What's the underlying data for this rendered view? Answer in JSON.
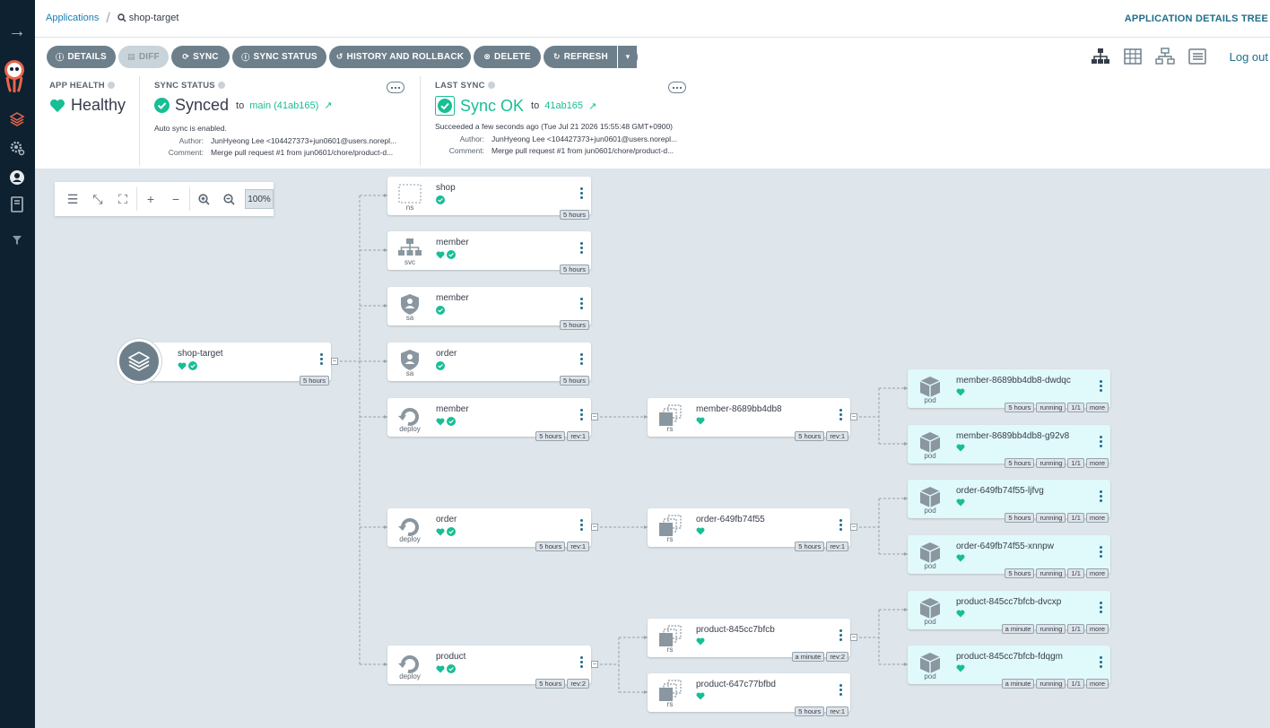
{
  "topbar": {
    "breadcrumb_root": "Applications",
    "breadcrumb_current": "shop-target",
    "page_title": "APPLICATION DETAILS TREE",
    "logout": "Log out"
  },
  "toolbar": {
    "details": "DETAILS",
    "diff": "DIFF",
    "sync": "SYNC",
    "sync_status": "SYNC STATUS",
    "history": "HISTORY AND ROLLBACK",
    "delete": "DELETE",
    "refresh": "REFRESH"
  },
  "health": {
    "label": "APP HEALTH",
    "value": "Healthy"
  },
  "sync_status": {
    "label": "SYNC STATUS",
    "value": "Synced",
    "to": "to",
    "revision": "main (41ab165)",
    "auto_sync": "Auto sync is enabled.",
    "author_label": "Author:",
    "author": "JunHyeong Lee <104427373+jun0601@users.norepl...",
    "comment_label": "Comment:",
    "comment": "Merge pull request #1 from jun0601/chore/product-d..."
  },
  "last_sync": {
    "label": "LAST SYNC",
    "value": "Sync OK",
    "to": "to",
    "revision": "41ab165",
    "succeeded": "Succeeded a few seconds ago (Tue Jul 21 2026 15:55:48 GMT+0900)",
    "author_label": "Author:",
    "author": "JunHyeong Lee <104427373+jun0601@users.norepl...",
    "comment_label": "Comment:",
    "comment": "Merge pull request #1 from jun0601/chore/product-d..."
  },
  "zoom": {
    "percent": "100%"
  },
  "root": {
    "name": "shop-target",
    "age": "5 hours"
  },
  "nodes": [
    {
      "name": "shop",
      "kind": "ns",
      "age": "5 hours"
    },
    {
      "name": "member",
      "kind": "svc",
      "age": "5 hours"
    },
    {
      "name": "member",
      "kind": "sa",
      "age": "5 hours"
    },
    {
      "name": "order",
      "kind": "sa",
      "age": "5 hours"
    },
    {
      "name": "member",
      "kind": "deploy",
      "age": "5 hours",
      "rev": "rev:1"
    },
    {
      "name": "order",
      "kind": "deploy",
      "age": "5 hours",
      "rev": "rev:1"
    },
    {
      "name": "product",
      "kind": "deploy",
      "age": "5 hours",
      "rev": "rev:2"
    },
    {
      "name": "member-8689bb4db8",
      "kind": "rs",
      "age": "5 hours",
      "rev": "rev:1"
    },
    {
      "name": "order-649fb74f55",
      "kind": "rs",
      "age": "5 hours",
      "rev": "rev:1"
    },
    {
      "name": "product-845cc7bfcb",
      "kind": "rs",
      "age": "a minute",
      "rev": "rev:2"
    },
    {
      "name": "product-647c77bfbd",
      "kind": "rs",
      "age": "5 hours",
      "rev": "rev:1"
    },
    {
      "name": "member-8689bb4db8-dwdqc",
      "kind": "pod",
      "age": "5 hours",
      "state": "running",
      "ready": "1/1",
      "more": "more"
    },
    {
      "name": "member-8689bb4db8-g92v8",
      "kind": "pod",
      "age": "5 hours",
      "state": "running",
      "ready": "1/1",
      "more": "more"
    },
    {
      "name": "order-649fb74f55-ljfvg",
      "kind": "pod",
      "age": "5 hours",
      "state": "running",
      "ready": "1/1",
      "more": "more"
    },
    {
      "name": "order-649fb74f55-xnnpw",
      "kind": "pod",
      "age": "5 hours",
      "state": "running",
      "ready": "1/1",
      "more": "more"
    },
    {
      "name": "product-845cc7bfcb-dvcxp",
      "kind": "pod",
      "age": "a minute",
      "state": "running",
      "ready": "1/1",
      "more": "more"
    },
    {
      "name": "product-845cc7bfcb-fdqgm",
      "kind": "pod",
      "age": "a minute",
      "state": "running",
      "ready": "1/1",
      "more": "more"
    }
  ],
  "colors": {
    "healthy": "#18be94",
    "sidebar": "#0d2130",
    "button": "#6d7f8b",
    "link": "#1f6e8a"
  }
}
